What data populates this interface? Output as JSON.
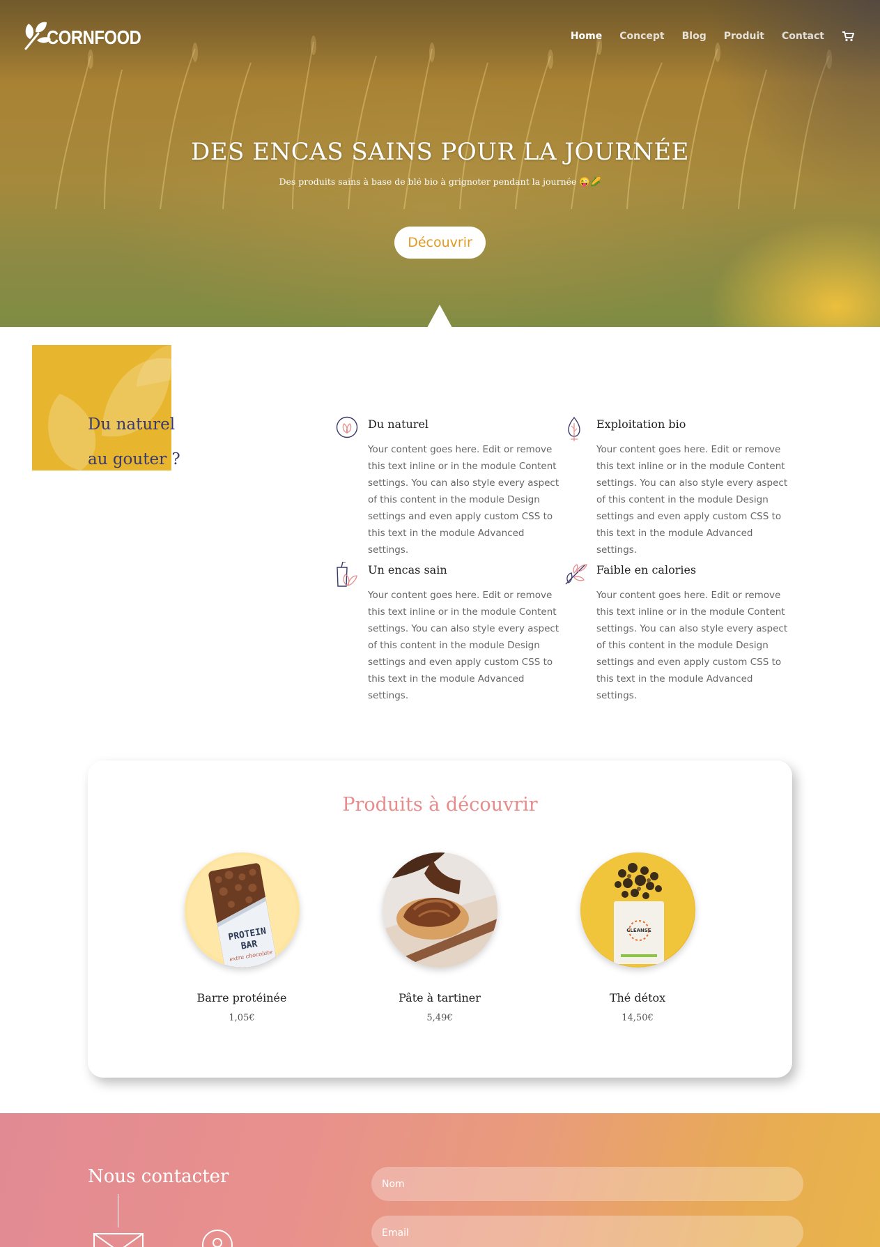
{
  "brand": {
    "name": "CORNFOOD"
  },
  "nav": {
    "items": [
      {
        "label": "Home",
        "active": true
      },
      {
        "label": "Concept",
        "active": false
      },
      {
        "label": "Blog",
        "active": false
      },
      {
        "label": "Produit",
        "active": false
      },
      {
        "label": "Contact",
        "active": false
      }
    ],
    "cart_icon": "cart-icon"
  },
  "hero": {
    "title": "DES ENCAS SAINS POUR LA JOURNÉE",
    "subtitle": "Des produits sains à base de blé bio à grignoter pendant la journée 😜🌽",
    "button_label": "Découvrir"
  },
  "features": {
    "heading_line1": "Du naturel",
    "heading_line2": "au gouter ?",
    "items": [
      {
        "icon": "leaf-circle-icon",
        "title": "Du naturel",
        "text": "Your content goes here. Edit or remove this text inline or in the module Content settings. You can also style every aspect of this content in the module Design settings and even apply custom CSS to this text in the module Advanced settings."
      },
      {
        "icon": "leaf-drop-icon",
        "title": "Exploitation bio",
        "text": "Your content goes here. Edit or remove this text inline or in the module Content settings. You can also style every aspect of this content in the module Design settings and even apply custom CSS to this text in the module Advanced settings."
      },
      {
        "icon": "drink-leaf-icon",
        "title": "Un encas sain",
        "text": "Your content goes here. Edit or remove this text inline or in the module Content settings. You can also style every aspect of this content in the module Design settings and even apply custom CSS to this text in the module Advanced settings."
      },
      {
        "icon": "branch-leaves-icon",
        "title": "Faible en calories",
        "text": "Your content goes here. Edit or remove this text inline or in the module Content settings. You can also style every aspect of this content in the module Design settings and even apply custom CSS to this text in the module Advanced settings."
      }
    ]
  },
  "products": {
    "title": "Produits à découvrir",
    "items": [
      {
        "name": "Barre protéinée",
        "price": "1,05€",
        "image": "protein-bar-image",
        "pack_line1": "PROTEIN",
        "pack_line2": "BAR",
        "pack_line3": "extra chocolate"
      },
      {
        "name": "Pâte à tartiner",
        "price": "5,49€",
        "image": "chocolate-spread-image"
      },
      {
        "name": "Thé détox",
        "price": "14,50€",
        "image": "detox-tea-image",
        "pack_label": "CLEANSE"
      }
    ]
  },
  "contact": {
    "title": "Nous contacter",
    "name_placeholder": "Nom",
    "email_placeholder": "Email"
  },
  "colors": {
    "accent_gold": "#e29a22",
    "navy": "#39396b",
    "coral": "#e88b8b",
    "yellow": "#e8b62e"
  }
}
